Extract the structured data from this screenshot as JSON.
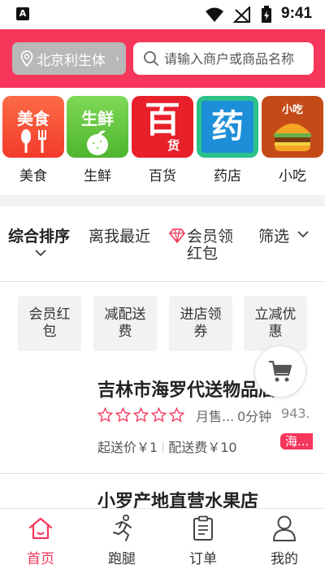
{
  "status_bar": {
    "time": "9:41"
  },
  "header": {
    "location_label": "北京利生体",
    "search_placeholder": "请输入商户或商品名称"
  },
  "categories": [
    {
      "label": "美食",
      "tile_text": "美食",
      "icon": "food-icon"
    },
    {
      "label": "生鲜",
      "tile_text": "生鲜",
      "icon": "fresh-icon"
    },
    {
      "label": "百货",
      "tile_text": "百",
      "tile_subtext": "货",
      "icon": "department-store-icon"
    },
    {
      "label": "药店",
      "tile_text": "药",
      "icon": "pharmacy-icon"
    },
    {
      "label": "小吃",
      "tile_text": "小吃",
      "icon": "snack-icon"
    }
  ],
  "sort_bar": {
    "comprehensive": "综合排序",
    "nearest": "离我最近",
    "member_red_packet": "会员领红包",
    "filter": "筛选"
  },
  "filter_chips": [
    "会员红包",
    "减配送费",
    "进店领券",
    "立减优惠"
  ],
  "stores": [
    {
      "name": "吉林市海罗代送物品店",
      "rating_stars": 0,
      "monthly_sales": "月售...",
      "time": "0分钟",
      "distance": "943.",
      "min_order": "起送价￥1",
      "delivery_fee": "配送费￥10",
      "tag": "海..."
    },
    {
      "name": "小罗产地直营水果店"
    }
  ],
  "bottom_nav": [
    {
      "label": "首页",
      "icon": "home-icon",
      "active": true
    },
    {
      "label": "跑腿",
      "icon": "runner-icon",
      "active": false
    },
    {
      "label": "订单",
      "icon": "order-icon",
      "active": false
    },
    {
      "label": "我的",
      "icon": "profile-icon",
      "active": false
    }
  ],
  "colors": {
    "brand": "#f7365c",
    "chip_bg": "#f2f2f2",
    "location_bg": "#b8b8b8"
  }
}
